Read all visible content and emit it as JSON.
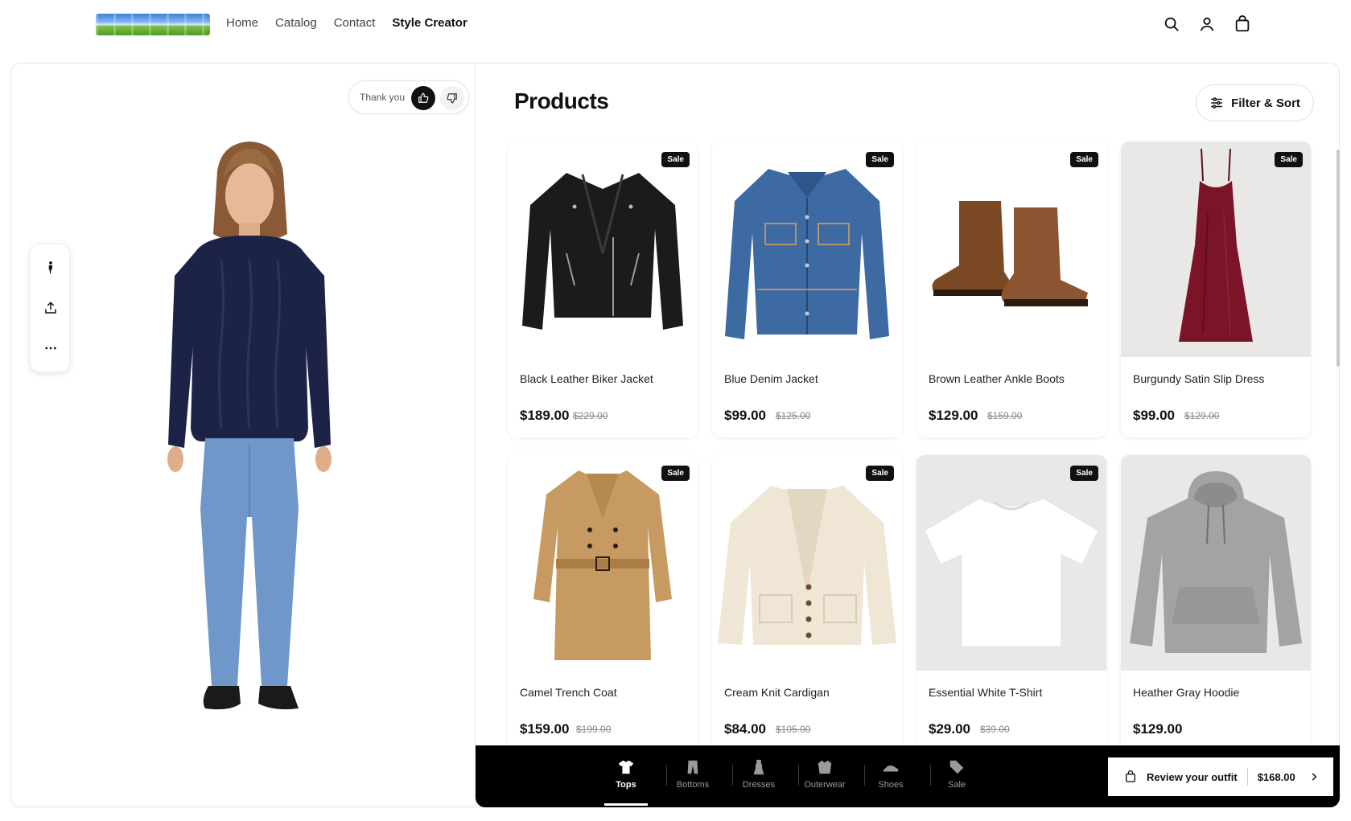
{
  "header": {
    "nav": [
      {
        "label": "Home",
        "active": false
      },
      {
        "label": "Catalog",
        "active": false
      },
      {
        "label": "Contact",
        "active": false
      },
      {
        "label": "Style Creator",
        "active": true
      }
    ],
    "icons": [
      "search-icon",
      "user-icon",
      "shopping-bag-icon"
    ]
  },
  "left_panel": {
    "feedback": {
      "label": "Thank you",
      "up_icon": "thumbs-up-icon",
      "down_icon": "thumbs-down-icon"
    },
    "tools": [
      "person-icon",
      "share-icon",
      "more-icon"
    ]
  },
  "products": {
    "title": "Products",
    "filter_label": "Filter & Sort",
    "items": [
      {
        "name": "Black Leather Biker Jacket",
        "price": "$189.00",
        "original": "$229.00",
        "badge": "Sale",
        "kind": "jacket-leather"
      },
      {
        "name": "Blue Denim Jacket",
        "price": "$99.00",
        "original": "$125.00",
        "badge": "Sale",
        "kind": "jacket-denim"
      },
      {
        "name": "Brown Leather Ankle Boots",
        "price": "$129.00",
        "original": "$159.00",
        "badge": "Sale",
        "kind": "boots"
      },
      {
        "name": "Burgundy Satin Slip Dress",
        "price": "$99.00",
        "original": "$129.00",
        "badge": "Sale",
        "kind": "dress"
      },
      {
        "name": "Camel Trench Coat",
        "price": "$159.00",
        "original": "$199.00",
        "badge": "Sale",
        "kind": "trench"
      },
      {
        "name": "Cream Knit Cardigan",
        "price": "$84.00",
        "original": "$105.00",
        "badge": "Sale",
        "kind": "cardigan"
      },
      {
        "name": "Essential White T-Shirt",
        "price": "$29.00",
        "original": "$39.00",
        "badge": "Sale",
        "kind": "tshirt"
      },
      {
        "name": "Heather Gray Hoodie",
        "price": "$129.00",
        "original": "",
        "badge": "",
        "kind": "hoodie"
      }
    ]
  },
  "bottom_bar": {
    "categories": [
      {
        "label": "Tops",
        "active": true
      },
      {
        "label": "Bottoms",
        "active": false
      },
      {
        "label": "Dresses",
        "active": false
      },
      {
        "label": "Outerwear",
        "active": false
      },
      {
        "label": "Shoes",
        "active": false
      },
      {
        "label": "Sale",
        "active": false
      }
    ],
    "review_label": "Review your outfit",
    "review_total": "$168.00"
  },
  "colors": {
    "accent": "#000000",
    "sale_badge": "#111111"
  }
}
